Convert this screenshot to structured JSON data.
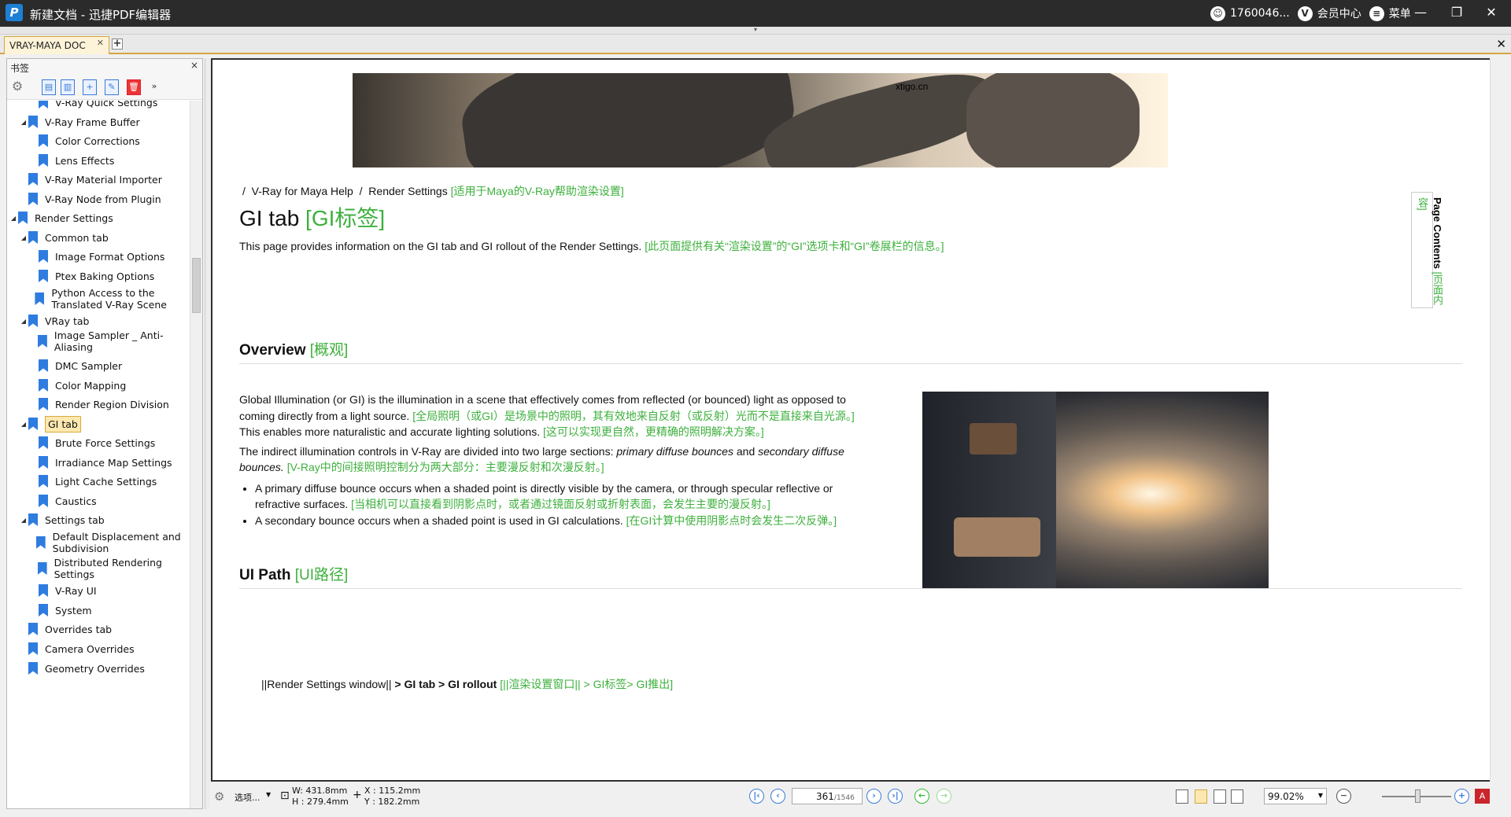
{
  "window": {
    "title": "新建文档 - 迅捷PDF编辑器",
    "user": "1760046...",
    "vip": "会员中心",
    "menu": "菜单"
  },
  "tabs": {
    "doc_tab": "VRAY-MAYA DOC"
  },
  "sidebar": {
    "title": "书签",
    "items": [
      {
        "label": "V-Ray Quick Settings",
        "level": 2
      },
      {
        "label": "V-Ray Frame Buffer",
        "level": 1,
        "expanded": true
      },
      {
        "label": "Color Corrections",
        "level": 2
      },
      {
        "label": "Lens Effects",
        "level": 2
      },
      {
        "label": "V-Ray Material Importer",
        "level": 1
      },
      {
        "label": "V-Ray Node from Plugin",
        "level": 1
      },
      {
        "label": "Render Settings",
        "level": 0,
        "expanded": true
      },
      {
        "label": "Common tab",
        "level": 1,
        "expanded": true
      },
      {
        "label": "Image Format Options",
        "level": 2
      },
      {
        "label": "Ptex Baking Options",
        "level": 2
      },
      {
        "label": "Python Access to the Translated V-Ray Scene",
        "level": 2
      },
      {
        "label": "VRay tab",
        "level": 1,
        "expanded": true
      },
      {
        "label": "Image Sampler _ Anti-Aliasing",
        "level": 2
      },
      {
        "label": "DMC Sampler",
        "level": 2
      },
      {
        "label": "Color Mapping",
        "level": 2
      },
      {
        "label": "Render Region Division",
        "level": 2
      },
      {
        "label": "GI tab",
        "level": 1,
        "expanded": true,
        "selected": true
      },
      {
        "label": "Brute Force Settings",
        "level": 2
      },
      {
        "label": "Irradiance Map Settings",
        "level": 2
      },
      {
        "label": "Light Cache Settings",
        "level": 2
      },
      {
        "label": "Caustics",
        "level": 2
      },
      {
        "label": "Settings tab",
        "level": 1,
        "expanded": true
      },
      {
        "label": "Default Displacement and Subdivision",
        "level": 2
      },
      {
        "label": "Distributed Rendering Settings",
        "level": 2
      },
      {
        "label": "V-Ray UI",
        "level": 2
      },
      {
        "label": "System",
        "level": 2
      },
      {
        "label": "Overrides tab",
        "level": 1
      },
      {
        "label": "Camera Overrides",
        "level": 1
      },
      {
        "label": "Geometry Overrides",
        "level": 1
      }
    ]
  },
  "page": {
    "watermark": "xtigo.cn",
    "crumb_sep": "/",
    "crumb1": "V-Ray for Maya Help",
    "crumb2": "Render Settings",
    "crumb_cn": "[适用于Maya的V-Ray帮助渲染设置]",
    "title": "GI tab",
    "title_cn": "[GI标签]",
    "intro": "This page provides information on the GI tab and GI rollout of the Render Settings.",
    "intro_cn": "[此页面提供有关“渲染设置”的“GI”选项卡和“GI”卷展栏的信息。]",
    "page_contents": "Page Contents",
    "page_contents_cn": "[页面内容]",
    "overview": "Overview",
    "overview_cn": "[概观]",
    "p1": "Global Illumination (or GI) is the illumination in a scene that effectively comes from reflected (or bounced) light as opposed to coming directly from a light source.",
    "p1_cn": "[全局照明（或GI）是场景中的照明，其有效地来自反射（或反射）光而不是直接来自光源。]",
    "p1b": "This enables more naturalistic and accurate lighting solutions.",
    "p1b_cn": "[这可以实现更自然，更精确的照明解决方案。]",
    "p2a": "The indirect illumination controls in V-Ray are divided into two large sections:",
    "p2_em1": "primary diffuse bounces",
    "p2_and": "and",
    "p2_em2": "secondary diffuse bounces.",
    "p2_cn": "[V-Ray中的间接照明控制分为两大部分：主要漫反射和次漫反射。]",
    "li1": "A primary diffuse bounce occurs when a shaded point is directly visible by the camera, or through specular reflective or refractive surfaces.",
    "li1_cn": "[当相机可以直接看到阴影点时，或者通过镜面反射或折射表面，会发生主要的漫反射。]",
    "li2": "A secondary bounce occurs when a shaded point is used in GI calculations.",
    "li2_cn": "[在GI计算中使用阴影点时会发生二次反弹。]",
    "uipath": "UI Path",
    "uipath_cn": "[UI路径]",
    "path_a": "||Render Settings window||",
    "path_b": "> GI tab > GI rollout",
    "path_cn": "[||渲染设置窗口|| > GI标签> GI推出]"
  },
  "status": {
    "options": "选项...",
    "w": "W: 431.8mm",
    "h": "H : 279.4mm",
    "x": "X : 115.2mm",
    "y": "Y : 182.2mm",
    "page": "361",
    "total": "/1546",
    "zoom": "99.02%"
  }
}
